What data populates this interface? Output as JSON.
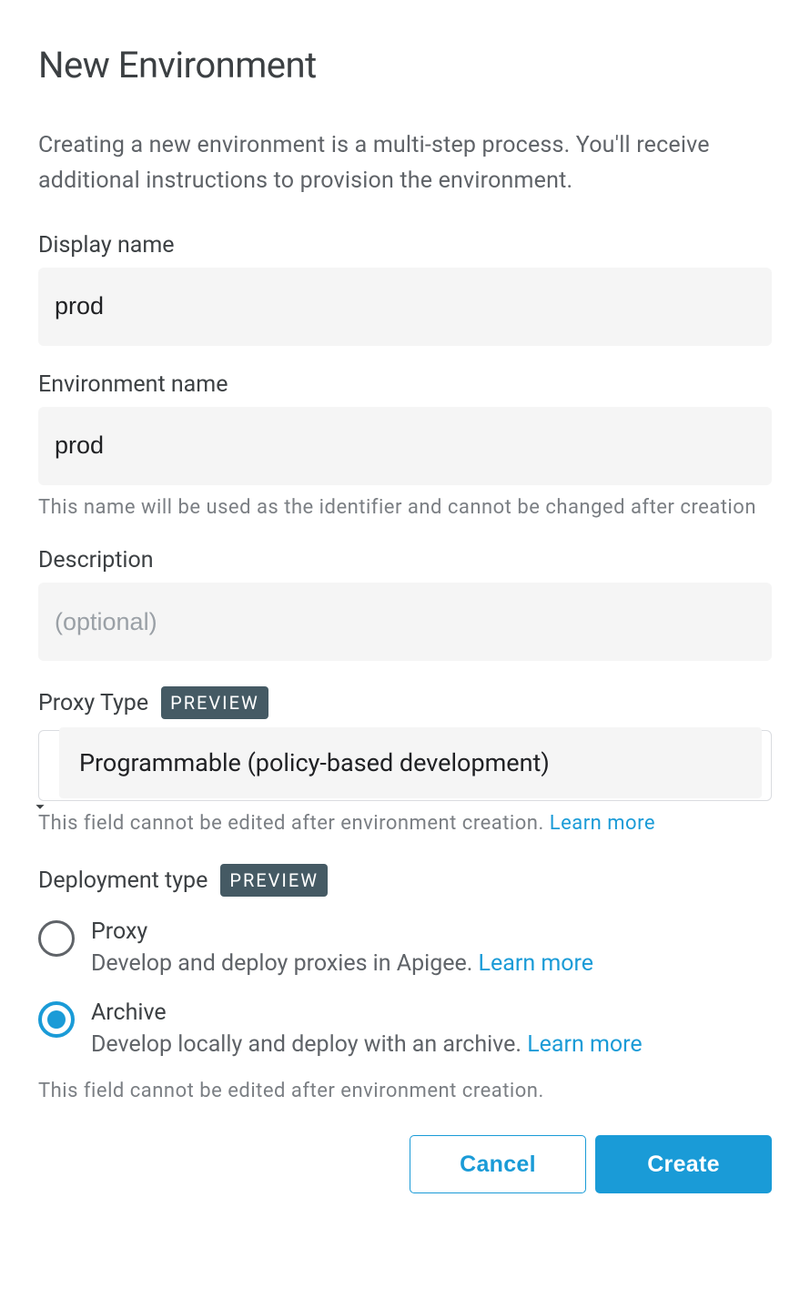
{
  "title": "New Environment",
  "intro": "Creating a new environment is a multi-step process. You'll receive additional instructions to provision the environment.",
  "display_name": {
    "label": "Display name",
    "value": "prod"
  },
  "environment_name": {
    "label": "Environment name",
    "value": "prod",
    "helper": "This name will be used as the identifier and cannot be changed after creation"
  },
  "description": {
    "label": "Description",
    "placeholder": "(optional)",
    "value": ""
  },
  "proxy_type": {
    "label": "Proxy Type",
    "badge": "PREVIEW",
    "selected": "Programmable (policy-based development)",
    "helper_prefix": "This field cannot be edited after environment creation. ",
    "learn_more": "Learn more"
  },
  "deployment_type": {
    "label": "Deployment type",
    "badge": "PREVIEW",
    "options": [
      {
        "title": "Proxy",
        "desc_prefix": "Develop and deploy proxies in Apigee. ",
        "learn_more": "Learn more",
        "selected": false
      },
      {
        "title": "Archive",
        "desc_prefix": "Develop locally and deploy with an archive. ",
        "learn_more": "Learn more",
        "selected": true
      }
    ],
    "helper": "This field cannot be edited after environment creation."
  },
  "buttons": {
    "cancel": "Cancel",
    "create": "Create"
  }
}
